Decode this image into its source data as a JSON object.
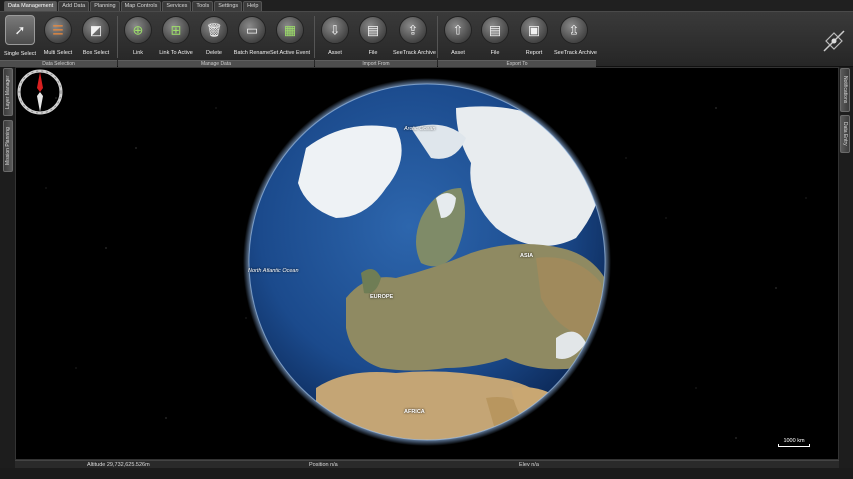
{
  "tabs": [
    {
      "label": "Data Management",
      "active": true
    },
    {
      "label": "Add Data"
    },
    {
      "label": "Planning"
    },
    {
      "label": "Map Controls"
    },
    {
      "label": "Services"
    },
    {
      "label": "Tools"
    },
    {
      "label": "Settings"
    },
    {
      "label": "Help"
    }
  ],
  "groups": {
    "data_selection": {
      "label": "Data Selection",
      "buttons": [
        {
          "label": "Single Select",
          "icon": "cursor-icon"
        },
        {
          "label": "Multi Select",
          "icon": "multi-select-icon"
        },
        {
          "label": "Box Select",
          "icon": "box-select-icon"
        }
      ]
    },
    "manage_data": {
      "label": "Manage Data",
      "buttons": [
        {
          "label": "Link",
          "icon": "link-icon"
        },
        {
          "label": "Link To Active",
          "icon": "link-to-active-icon"
        },
        {
          "label": "Delete",
          "icon": "trash-icon"
        },
        {
          "label": "Batch Rename",
          "icon": "rename-icon"
        },
        {
          "label": "Set Active Event",
          "icon": "calendar-icon"
        }
      ]
    },
    "import_from": {
      "label": "Import From",
      "buttons": [
        {
          "label": "Asset",
          "icon": "asset-import-icon"
        },
        {
          "label": "File",
          "icon": "file-import-icon"
        },
        {
          "label": "SeeTrack Archive",
          "icon": "archive-import-icon"
        }
      ]
    },
    "export_to": {
      "label": "Export To",
      "buttons": [
        {
          "label": "Asset",
          "icon": "asset-export-icon"
        },
        {
          "label": "File",
          "icon": "file-export-icon"
        },
        {
          "label": "Report",
          "icon": "report-icon"
        },
        {
          "label": "SeeTrack Archive",
          "icon": "archive-export-icon"
        }
      ]
    }
  },
  "side_tabs": {
    "left": [
      "Layer Manager",
      "Mission Planning"
    ],
    "right": [
      "Notifications",
      "Data Entry"
    ]
  },
  "map": {
    "labels": {
      "arctic": "Arctic Ocean",
      "atlantic": "North Atlantic Ocean",
      "europe": "EUROPE",
      "asia": "ASIA",
      "africa": "AFRICA"
    },
    "scale": "1000 km"
  },
  "status": {
    "altitude": "Altitude 29,732,625.526m",
    "position": "Position n/a",
    "elevation": "Elev n/a"
  },
  "colors": {
    "ocean": "#1d4a8a",
    "land": "#b99a6a",
    "ice": "#f2f4f6",
    "background": "#000000"
  }
}
